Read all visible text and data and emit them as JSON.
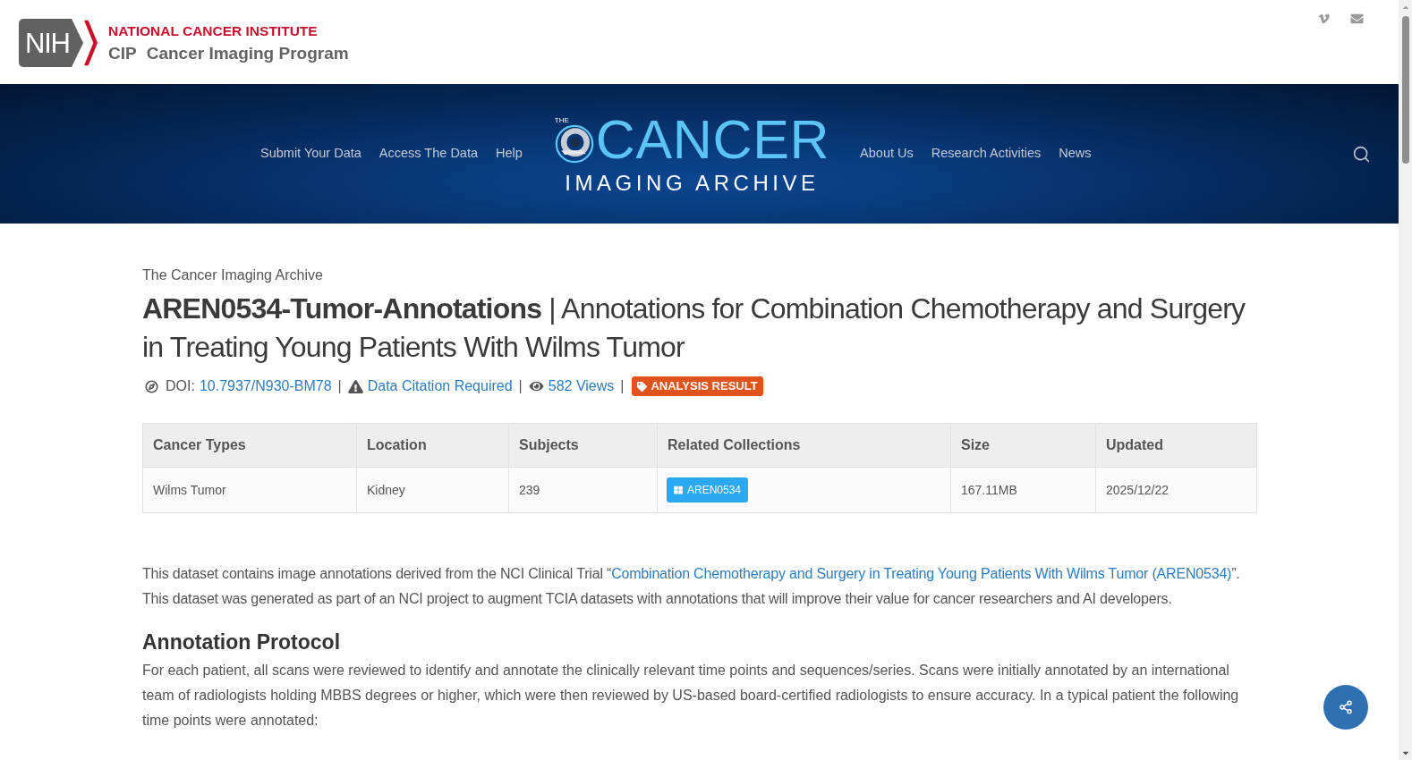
{
  "header": {
    "logo_badge": "NIH",
    "institute": "NATIONAL CANCER INSTITUTE",
    "program_abbr": "CIP",
    "program": "Cancer Imaging Program"
  },
  "nav": {
    "left": [
      "Submit Your Data",
      "Access The Data",
      "Help"
    ],
    "logo": {
      "small": "THE",
      "main": "CANCER",
      "sub": "IMAGING ARCHIVE"
    },
    "right": [
      "About Us",
      "Research Activities",
      "News"
    ]
  },
  "breadcrumb": "The Cancer Imaging Archive",
  "title": "**AREN0534-Tumor-Annotations** | Annotations for Combination Chemotherapy and Surgery in Treating Young Patients With Wilms Tumor",
  "meta": [
    {
      "kind": "doi",
      "label": "DOI:",
      "link": "10.7937/N930-BM78",
      "separator": "|"
    },
    {
      "kind": "citation",
      "link": "Data Citation Required",
      "separator": "|"
    },
    {
      "kind": "views",
      "link": "582 Views",
      "separator": "|"
    }
  ],
  "badge": {
    "label": "ANALYSIS RESULT"
  },
  "table": {
    "columns": [
      "Cancer Types",
      "Location",
      "Subjects",
      "Related Collections",
      "Size",
      "Updated"
    ],
    "rows": [
      {
        "cells": [
          {
            "kind": "text",
            "text": "Wilms Tumor"
          },
          {
            "kind": "text",
            "text": "Kidney"
          },
          {
            "kind": "text",
            "text": "239"
          },
          {
            "kind": "collection",
            "text": "AREN0534"
          },
          {
            "kind": "text",
            "text": "167.11MB"
          },
          {
            "kind": "text",
            "text": "2025/12/22"
          }
        ]
      }
    ]
  },
  "description": [
    {
      "kind": "text",
      "text": "This dataset contains image annotations derived from the NCI Clinical Trial “"
    },
    {
      "kind": "link",
      "text": "Combination Chemotherapy and Surgery in Treating Young Patients With Wilms Tumor (AREN0534)"
    },
    {
      "kind": "text",
      "text": "”.  This dataset was generated as part of an NCI project to augment TCIA datasets with annotations that will improve their value for cancer researchers and AI developers."
    }
  ],
  "sections": [
    {
      "heading": "Annotation Protocol",
      "body": "For each patient, all scans were reviewed to identify and annotate the clinically relevant time points and sequences/series. Scans were initially annotated by an international team of radiologists holding MBBS degrees or higher, which were then reviewed by US-based board-certified radiologists to ensure accuracy. In a typical patient the following time points were annotated:"
    }
  ]
}
